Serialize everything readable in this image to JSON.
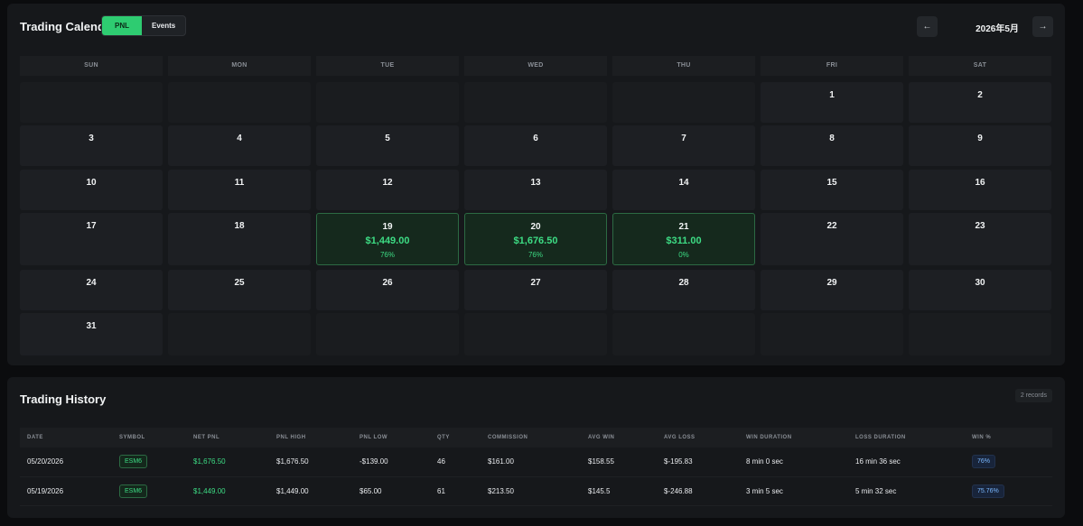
{
  "calendar": {
    "title": "Trading Calendar",
    "toggle": {
      "pnl": "PNL",
      "events": "Events"
    },
    "month": "2026年5月",
    "prev_icon": "←",
    "next_icon": "→",
    "weekdays": [
      "SUN",
      "MON",
      "TUE",
      "WED",
      "THU",
      "FRI",
      "SAT"
    ],
    "days": {
      "d1": "1",
      "d2": "2",
      "d3": "3",
      "d4": "4",
      "d5": "5",
      "d6": "6",
      "d7": "7",
      "d8": "8",
      "d9": "9",
      "d10": "10",
      "d11": "11",
      "d12": "12",
      "d13": "13",
      "d14": "14",
      "d15": "15",
      "d16": "16",
      "d17": "17",
      "d18": "18",
      "d19": "19",
      "d20": "20",
      "d21": "21",
      "d22": "22",
      "d23": "23",
      "d24": "24",
      "d25": "25",
      "d26": "26",
      "d27": "27",
      "d28": "28",
      "d29": "29",
      "d30": "30",
      "d31": "31"
    },
    "pnl": {
      "d19": {
        "value": "$1,449.00",
        "pct": "76%"
      },
      "d20": {
        "value": "$1,676.50",
        "pct": "76%"
      },
      "d21": {
        "value": "$311.00",
        "pct": "0%"
      }
    }
  },
  "history": {
    "title": "Trading History",
    "records": "2 records",
    "columns": [
      "DATE",
      "SYMBOL",
      "NET PNL",
      "PNL HIGH",
      "PNL LOW",
      "QTY",
      "COMMISSION",
      "AVG WIN",
      "AVG LOSS",
      "WIN DURATION",
      "LOSS DURATION",
      "WIN %"
    ],
    "rows": [
      [
        "05/20/2026",
        "ESM6",
        "$1,676.50",
        "$1,676.50",
        "-$139.00",
        "46",
        "$161.00",
        "$158.55",
        "$-195.83",
        "8 min 0 sec",
        "16 min 36 sec",
        "76%"
      ],
      [
        "05/19/2026",
        "ESM6",
        "$1,449.00",
        "$1,449.00",
        "$65.00",
        "61",
        "$213.50",
        "$145.5",
        "$-246.88",
        "3 min 5 sec",
        "5 min 32 sec",
        "75.76%"
      ]
    ]
  },
  "colors": {
    "accent": "#2ecc71",
    "profit": "#3ddc84",
    "background": "#0b0c0e",
    "panel": "#16181b"
  }
}
